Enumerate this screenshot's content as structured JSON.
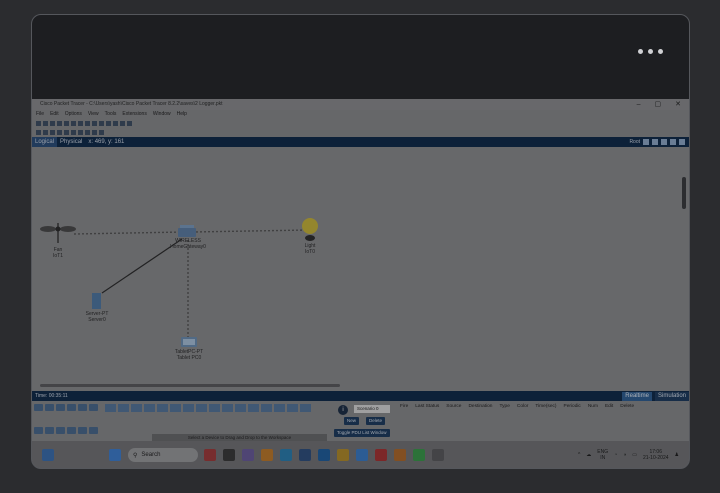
{
  "window": {
    "title": "Cisco Packet Tracer - C:\\Users\\yash\\Cisco Packet Tracer 8.2.2\\saves\\2 Logger.pkt",
    "controls": [
      "–",
      "▢",
      "✕"
    ]
  },
  "menu": [
    "File",
    "Edit",
    "Options",
    "View",
    "Tools",
    "Extensions",
    "Window",
    "Help"
  ],
  "modes": {
    "logical": "Logical",
    "physical": "Physical",
    "coords": "x: 469, y: 161"
  },
  "modebar_right": {
    "root": "Root"
  },
  "devices": {
    "fan": {
      "name": "Fan",
      "sub": "IoT1"
    },
    "router": {
      "name": "WIRELESS",
      "sub": "HomeGateway0"
    },
    "light": {
      "name": "Light",
      "sub": "IoT0"
    },
    "server": {
      "name": "Server-PT",
      "sub": "Server0"
    },
    "tablet": {
      "name": "TabletPC-PT",
      "sub": "Tablet PC0"
    }
  },
  "status": {
    "time": "Time: 00:35:11",
    "realtime": "Realtime",
    "simulation": "Simulation"
  },
  "palette": {
    "hint": "Select a Device to Drag and Drop to the Workspace"
  },
  "scenario": {
    "select": "Scenario 0",
    "new": "New",
    "delete": "Delete",
    "toggle": "Toggle PDU List Window"
  },
  "pdu_headers": [
    "Fire",
    "Last Status",
    "Source",
    "Destination",
    "Type",
    "Color",
    "Time(sec)",
    "Periodic",
    "Num",
    "Edit",
    "Delete"
  ],
  "taskbar": {
    "search": "Search",
    "lang": "ENG",
    "region": "IN",
    "time": "17:06",
    "date": "21-10-2024"
  },
  "colors": {
    "accent": "#2f5f94",
    "titlebar": "#0f2a4a"
  }
}
